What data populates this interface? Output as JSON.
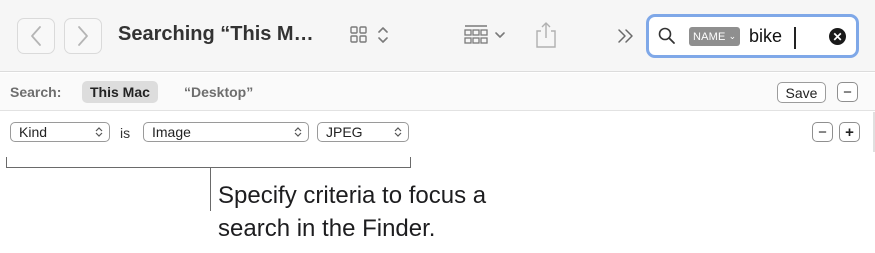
{
  "toolbar": {
    "title": "Searching “This M…",
    "search": {
      "token_label": "NAME",
      "token_chevron": "⌄",
      "value": "bike",
      "clear_glyph": "✕"
    }
  },
  "scope_bar": {
    "label": "Search:",
    "active_scope": "This Mac",
    "other_scope": "“Desktop”",
    "save_label": "Save",
    "remove_label": "−"
  },
  "criteria": {
    "attribute": "Kind",
    "operator": "is",
    "kind_value": "Image",
    "type_value": "JPEG",
    "remove_label": "−",
    "add_label": "+"
  },
  "callout": {
    "line1": "Specify criteria to focus a",
    "line2": "search in the Finder."
  },
  "colors": {
    "search_focus_ring": "#7fa8e8",
    "token_background": "#8f8f8f",
    "scope_active_background": "#dddddd"
  },
  "icons": [
    "chevron-left-icon",
    "chevron-right-icon",
    "grid-view-icon",
    "updown-chevron-icon",
    "group-by-icon",
    "share-icon",
    "overflow-chevrons-icon",
    "magnifier-icon",
    "clear-icon"
  ]
}
